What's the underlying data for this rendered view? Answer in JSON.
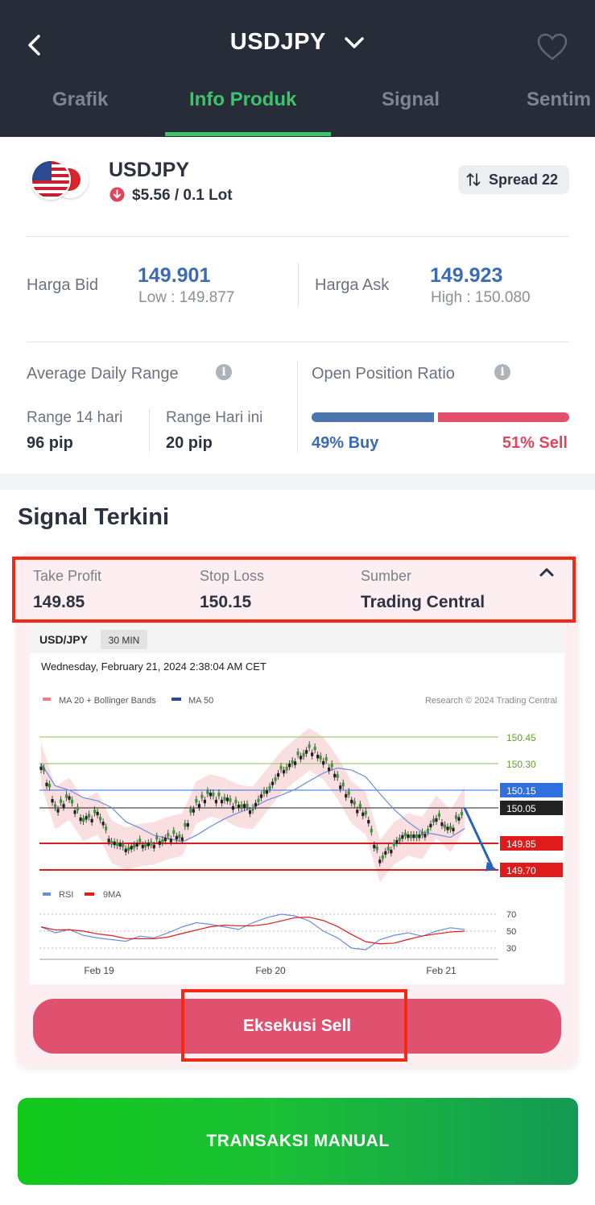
{
  "header": {
    "title": "USDJPY",
    "tabs": [
      "Grafik",
      "Info Produk",
      "Signal",
      "Sentim"
    ],
    "active_tab": "Info Produk"
  },
  "product": {
    "name": "USDJPY",
    "change_direction": "down",
    "lot_value": "$5.56 / 0.1 Lot",
    "spread": "Spread 22"
  },
  "prices": {
    "bid_label": "Harga Bid",
    "bid_value": "149.901",
    "low": "Low : 149.877",
    "ask_label": "Harga Ask",
    "ask_value": "149.923",
    "high": "High : 150.080"
  },
  "adr": {
    "title": "Average Daily Range",
    "range14_label": "Range 14 hari",
    "range14_value": "96 pip",
    "today_label": "Range Hari ini",
    "today_value": "20 pip"
  },
  "opr": {
    "title": "Open Position Ratio",
    "buy_percent": 49,
    "sell_percent": 51,
    "buy_text": "49% Buy",
    "sell_text": "51% Sell"
  },
  "signal": {
    "section_title": "Signal Terkini",
    "take_profit_label": "Take Profit",
    "take_profit_value": "149.85",
    "stop_loss_label": "Stop Loss",
    "stop_loss_value": "150.15",
    "source_label": "Sumber",
    "source_value": "Trading Central",
    "execute_label": "Eksekusi Sell"
  },
  "chart_data": {
    "type": "line",
    "title": "USD/JPY",
    "timeframe": "30 MIN",
    "timestamp": "Wednesday, February 21, 2024 2:38:04 AM CET",
    "legend": [
      "MA 20 + Bollinger Bands",
      "MA 50"
    ],
    "credit": "Research © 2024 Trading Central",
    "x_ticks": [
      "Feb 19",
      "Feb 20",
      "Feb 21"
    ],
    "price_levels": [
      {
        "label": "150.45",
        "color": "#8cc34a"
      },
      {
        "label": "150.30",
        "color": "#8cc34a"
      },
      {
        "label": "150.15",
        "color": "#2f6fe0"
      },
      {
        "label": "150.05",
        "color": "#222222"
      },
      {
        "label": "149.85",
        "color": "#e01b1b"
      },
      {
        "label": "149.70",
        "color": "#e01b1b"
      }
    ],
    "price_series": [
      150.3,
      150.05,
      150.1,
      149.98,
      150.02,
      149.86,
      149.82,
      149.84,
      149.85,
      149.88,
      149.9,
      150.08,
      150.12,
      150.1,
      150.06,
      150.05,
      150.15,
      150.25,
      150.32,
      150.38,
      150.33,
      150.22,
      150.08,
      150.02,
      149.75,
      149.85,
      149.9,
      149.88,
      150.0,
      149.92,
      150.05
    ],
    "rsi_legend": [
      "RSI",
      "9MA"
    ],
    "rsi_ticks": [
      "70",
      "50",
      "30"
    ],
    "rsi_series": [
      55,
      48,
      52,
      45,
      42,
      40,
      38,
      44,
      42,
      48,
      55,
      60,
      58,
      55,
      52,
      60,
      66,
      70,
      68,
      62,
      50,
      42,
      30,
      28,
      40,
      45,
      48,
      44,
      50,
      54,
      52
    ]
  },
  "footer": {
    "manual_label": "TRANSAKSI MANUAL"
  }
}
